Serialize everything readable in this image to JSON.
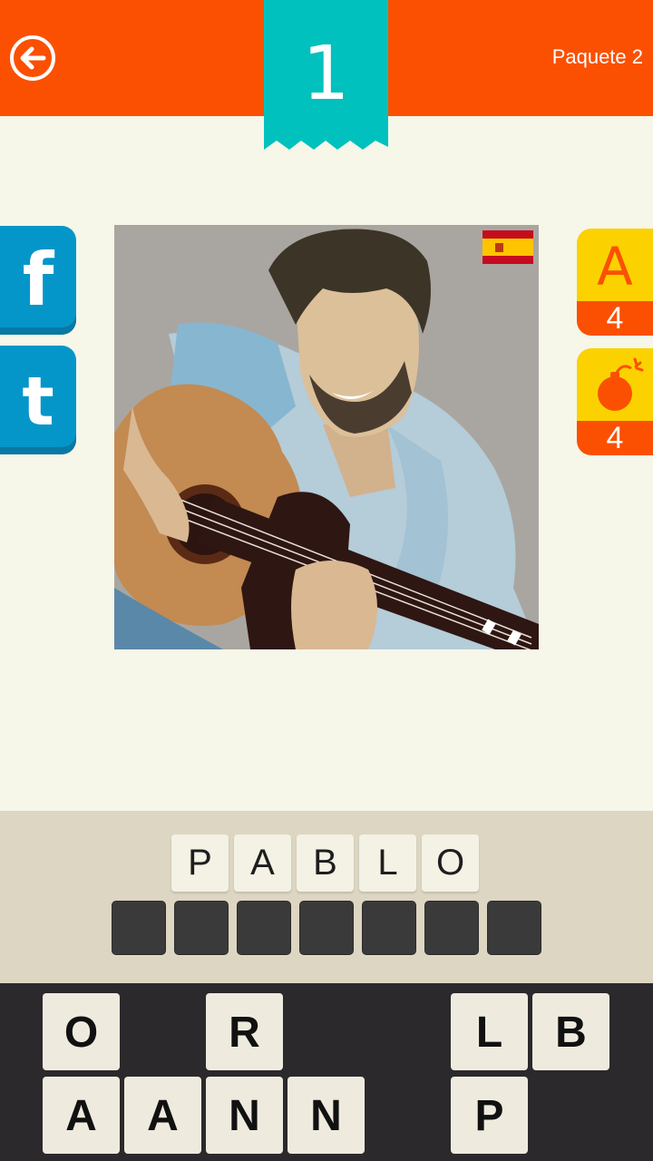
{
  "header": {
    "back_icon": "back-arrow-icon",
    "level": "1",
    "pack_label": "Paquete 2",
    "colors": {
      "bar": "#fb5002",
      "ribbon": "#00c1bd"
    }
  },
  "share": {
    "facebook_label": "f",
    "twitter_label": "t"
  },
  "hints": {
    "letter_hint": {
      "glyph": "A",
      "count": "4"
    },
    "bomb_hint": {
      "icon": "bomb-icon",
      "count": "4"
    }
  },
  "puzzle": {
    "image": "man-playing-guitar-illustration",
    "flag": "spain-flag-icon"
  },
  "answer": {
    "first_word": [
      "P",
      "A",
      "B",
      "L",
      "O"
    ],
    "second_word_slots": 7
  },
  "keyboard": {
    "row1": [
      "O",
      "",
      "R",
      "",
      "",
      "L",
      "B"
    ],
    "row2": [
      "A",
      "A",
      "N",
      "N",
      "",
      "P",
      ""
    ]
  }
}
